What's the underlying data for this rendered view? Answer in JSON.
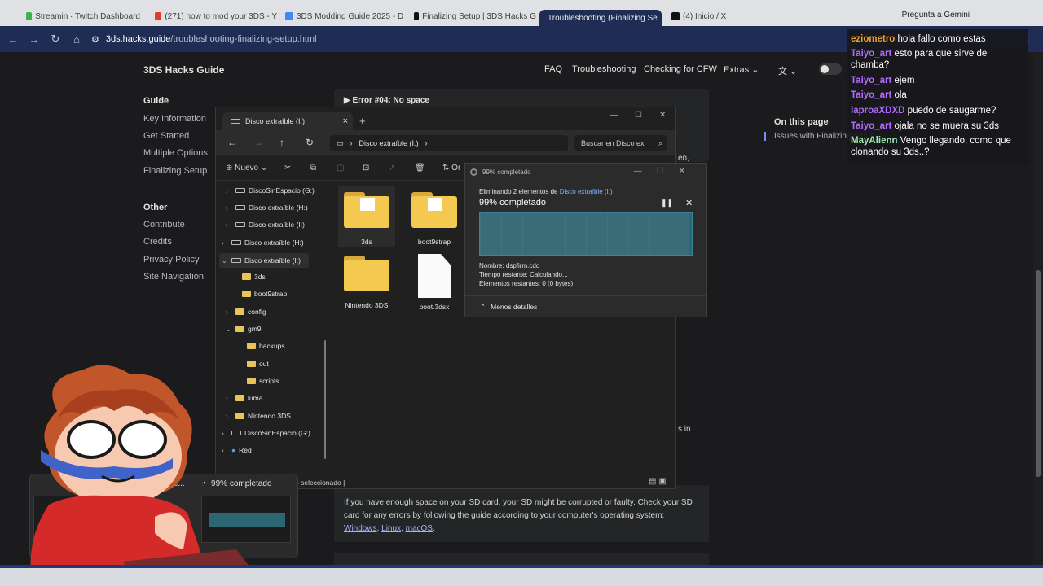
{
  "browser": {
    "tabs": [
      {
        "label": "Streamin · Twitch Dashboard",
        "color": "#3bb449"
      },
      {
        "label": "(271) how to mod your 3DS - Y",
        "color": "#e53935"
      },
      {
        "label": "3DS Modding Guide 2025 - D",
        "color": "#4285f4"
      },
      {
        "label": "Finalizing Setup | 3DS Hacks G",
        "color": "#111111"
      },
      {
        "label": "Troubleshooting (Finalizing Se",
        "color": "#111111"
      },
      {
        "label": "(4) Inicio / X",
        "color": "#111111"
      }
    ],
    "gemini_label": "Pregunta a Gemini",
    "url_domain": "3ds.hacks.guide",
    "url_path": "/troubleshooting-finalizing-setup.html"
  },
  "site": {
    "title": "3DS Hacks Guide",
    "topnav": [
      "FAQ",
      "Troubleshooting",
      "Checking for CFW",
      "Extras"
    ],
    "sidebar": {
      "guide_heading": "Guide",
      "guide_links": [
        "Key Information",
        "Get Started",
        "Multiple Options",
        "Finalizing Setup"
      ],
      "other_heading": "Other",
      "other_links": [
        "Contribute",
        "Credits",
        "Privacy Policy",
        "Site Navigation"
      ]
    },
    "error_summary": "Error #04: No space",
    "on_this_page": "On this page",
    "toc_item": "Issues with Finalizing Setup",
    "edge_text_1": "en,",
    "edge_text_2": "s in",
    "paragraph_text": "If you have enough space on your SD card, your SD might be corrupted or faulty. Check your SD card for any errors by following the guide according to your computer's operating system:",
    "os_links": [
      "Windows",
      "Linux",
      "macOS"
    ],
    "link_sep": ",",
    "period": "."
  },
  "explorer": {
    "tab_title": "Disco extraíble (I:)",
    "breadcrumb": "Disco extraíble (I:)",
    "search_placeholder": "Buscar en Disco ex",
    "new_label": "Nuevo",
    "sort_label": "Or",
    "tree": [
      {
        "label": "DiscoSinEspacio (G:)",
        "kind": "drive",
        "indent": 0,
        "chev": "›"
      },
      {
        "label": "Disco extraíble (H:)",
        "kind": "drive",
        "indent": 0,
        "chev": "›"
      },
      {
        "label": "Disco extraíble (I:)",
        "kind": "drive",
        "indent": 0,
        "chev": "›"
      },
      {
        "label": "Disco extraíble (H:)",
        "kind": "drive",
        "indent": -1,
        "chev": "›"
      },
      {
        "label": "Disco extraíble (I:)",
        "kind": "drive",
        "indent": -1,
        "chev": "⌄"
      },
      {
        "label": "3ds",
        "kind": "folder",
        "indent": 1,
        "chev": ""
      },
      {
        "label": "boot9strap",
        "kind": "folder",
        "indent": 1,
        "chev": ""
      },
      {
        "label": "config",
        "kind": "folder",
        "indent": 1,
        "chev": "›"
      },
      {
        "label": "gm9",
        "kind": "folder",
        "indent": 1,
        "chev": "⌄"
      },
      {
        "label": "backups",
        "kind": "folder",
        "indent": 2,
        "chev": ""
      },
      {
        "label": "out",
        "kind": "folder",
        "indent": 2,
        "chev": ""
      },
      {
        "label": "scripts",
        "kind": "folder",
        "indent": 2,
        "chev": ""
      },
      {
        "label": "luma",
        "kind": "folder",
        "indent": 1,
        "chev": "›"
      },
      {
        "label": "Nintendo 3DS",
        "kind": "folder",
        "indent": 1,
        "chev": "›"
      },
      {
        "label": "DiscoSinEspacio (G:)",
        "kind": "drive",
        "indent": -1,
        "chev": "›"
      },
      {
        "label": "Red",
        "kind": "net",
        "indent": -1,
        "chev": "›"
      }
    ],
    "files": [
      {
        "name": "3ds",
        "kind": "folder"
      },
      {
        "name": "boot9strap",
        "kind": "folder"
      },
      {
        "name": "Nintendo 3DS",
        "kind": "folder"
      },
      {
        "name": "boot.3dsx",
        "kind": "file"
      }
    ],
    "status": "o seleccionado"
  },
  "progress": {
    "title": "99% completado",
    "desc_prefix": "Eliminando 2 elementos de",
    "desc_link": "Disco extraíble (I:)",
    "percent_label": "99% completado",
    "percent_value": 99,
    "name_line": "Nombre:  dspfirm.cdc",
    "time_line": "Tiempo restante:  Calculando...",
    "items_line": "Elementos restantes:  0 (0 bytes)",
    "less_details": "Menos detalles"
  },
  "chat": [
    {
      "user": "eziometro",
      "color": "#f0a030",
      "text": "hola fallo como estas"
    },
    {
      "user": "Taiyo_art",
      "color": "#b06bff",
      "text": "esto para que sirve de chamba?"
    },
    {
      "user": "Taiyo_art",
      "color": "#b06bff",
      "text": "ejem"
    },
    {
      "user": "Taiyo_art",
      "color": "#b06bff",
      "text": "ola"
    },
    {
      "user": "laproaXDXD",
      "color": "#b06bff",
      "text": "puedo de saugarme?"
    },
    {
      "user": "Taiyo_art",
      "color": "#b06bff",
      "text": "ojala no se muera su 3ds"
    },
    {
      "user": "MayAlienn",
      "color": "#9ee6b0",
      "text": "Vengo llegando, como que clonando su 3ds..?"
    }
  ],
  "taskbar_preview": {
    "left_label": "ole...",
    "right_label": "99% completado"
  }
}
